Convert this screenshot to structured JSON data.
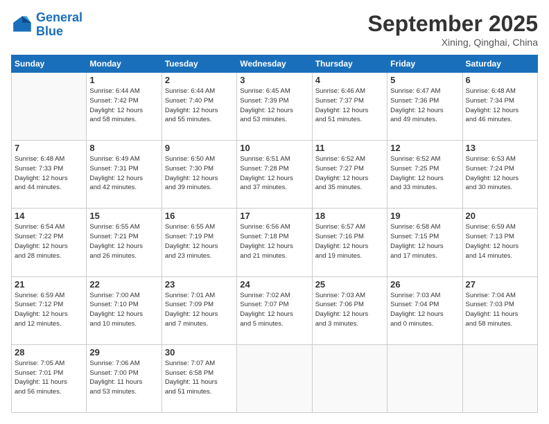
{
  "logo": {
    "line1": "General",
    "line2": "Blue"
  },
  "title": "September 2025",
  "location": "Xining, Qinghai, China",
  "weekdays": [
    "Sunday",
    "Monday",
    "Tuesday",
    "Wednesday",
    "Thursday",
    "Friday",
    "Saturday"
  ],
  "weeks": [
    [
      {
        "day": "",
        "info": ""
      },
      {
        "day": "1",
        "info": "Sunrise: 6:44 AM\nSunset: 7:42 PM\nDaylight: 12 hours\nand 58 minutes."
      },
      {
        "day": "2",
        "info": "Sunrise: 6:44 AM\nSunset: 7:40 PM\nDaylight: 12 hours\nand 55 minutes."
      },
      {
        "day": "3",
        "info": "Sunrise: 6:45 AM\nSunset: 7:39 PM\nDaylight: 12 hours\nand 53 minutes."
      },
      {
        "day": "4",
        "info": "Sunrise: 6:46 AM\nSunset: 7:37 PM\nDaylight: 12 hours\nand 51 minutes."
      },
      {
        "day": "5",
        "info": "Sunrise: 6:47 AM\nSunset: 7:36 PM\nDaylight: 12 hours\nand 49 minutes."
      },
      {
        "day": "6",
        "info": "Sunrise: 6:48 AM\nSunset: 7:34 PM\nDaylight: 12 hours\nand 46 minutes."
      }
    ],
    [
      {
        "day": "7",
        "info": "Sunrise: 6:48 AM\nSunset: 7:33 PM\nDaylight: 12 hours\nand 44 minutes."
      },
      {
        "day": "8",
        "info": "Sunrise: 6:49 AM\nSunset: 7:31 PM\nDaylight: 12 hours\nand 42 minutes."
      },
      {
        "day": "9",
        "info": "Sunrise: 6:50 AM\nSunset: 7:30 PM\nDaylight: 12 hours\nand 39 minutes."
      },
      {
        "day": "10",
        "info": "Sunrise: 6:51 AM\nSunset: 7:28 PM\nDaylight: 12 hours\nand 37 minutes."
      },
      {
        "day": "11",
        "info": "Sunrise: 6:52 AM\nSunset: 7:27 PM\nDaylight: 12 hours\nand 35 minutes."
      },
      {
        "day": "12",
        "info": "Sunrise: 6:52 AM\nSunset: 7:25 PM\nDaylight: 12 hours\nand 33 minutes."
      },
      {
        "day": "13",
        "info": "Sunrise: 6:53 AM\nSunset: 7:24 PM\nDaylight: 12 hours\nand 30 minutes."
      }
    ],
    [
      {
        "day": "14",
        "info": "Sunrise: 6:54 AM\nSunset: 7:22 PM\nDaylight: 12 hours\nand 28 minutes."
      },
      {
        "day": "15",
        "info": "Sunrise: 6:55 AM\nSunset: 7:21 PM\nDaylight: 12 hours\nand 26 minutes."
      },
      {
        "day": "16",
        "info": "Sunrise: 6:55 AM\nSunset: 7:19 PM\nDaylight: 12 hours\nand 23 minutes."
      },
      {
        "day": "17",
        "info": "Sunrise: 6:56 AM\nSunset: 7:18 PM\nDaylight: 12 hours\nand 21 minutes."
      },
      {
        "day": "18",
        "info": "Sunrise: 6:57 AM\nSunset: 7:16 PM\nDaylight: 12 hours\nand 19 minutes."
      },
      {
        "day": "19",
        "info": "Sunrise: 6:58 AM\nSunset: 7:15 PM\nDaylight: 12 hours\nand 17 minutes."
      },
      {
        "day": "20",
        "info": "Sunrise: 6:59 AM\nSunset: 7:13 PM\nDaylight: 12 hours\nand 14 minutes."
      }
    ],
    [
      {
        "day": "21",
        "info": "Sunrise: 6:59 AM\nSunset: 7:12 PM\nDaylight: 12 hours\nand 12 minutes."
      },
      {
        "day": "22",
        "info": "Sunrise: 7:00 AM\nSunset: 7:10 PM\nDaylight: 12 hours\nand 10 minutes."
      },
      {
        "day": "23",
        "info": "Sunrise: 7:01 AM\nSunset: 7:09 PM\nDaylight: 12 hours\nand 7 minutes."
      },
      {
        "day": "24",
        "info": "Sunrise: 7:02 AM\nSunset: 7:07 PM\nDaylight: 12 hours\nand 5 minutes."
      },
      {
        "day": "25",
        "info": "Sunrise: 7:03 AM\nSunset: 7:06 PM\nDaylight: 12 hours\nand 3 minutes."
      },
      {
        "day": "26",
        "info": "Sunrise: 7:03 AM\nSunset: 7:04 PM\nDaylight: 12 hours\nand 0 minutes."
      },
      {
        "day": "27",
        "info": "Sunrise: 7:04 AM\nSunset: 7:03 PM\nDaylight: 11 hours\nand 58 minutes."
      }
    ],
    [
      {
        "day": "28",
        "info": "Sunrise: 7:05 AM\nSunset: 7:01 PM\nDaylight: 11 hours\nand 56 minutes."
      },
      {
        "day": "29",
        "info": "Sunrise: 7:06 AM\nSunset: 7:00 PM\nDaylight: 11 hours\nand 53 minutes."
      },
      {
        "day": "30",
        "info": "Sunrise: 7:07 AM\nSunset: 6:58 PM\nDaylight: 11 hours\nand 51 minutes."
      },
      {
        "day": "",
        "info": ""
      },
      {
        "day": "",
        "info": ""
      },
      {
        "day": "",
        "info": ""
      },
      {
        "day": "",
        "info": ""
      }
    ]
  ]
}
